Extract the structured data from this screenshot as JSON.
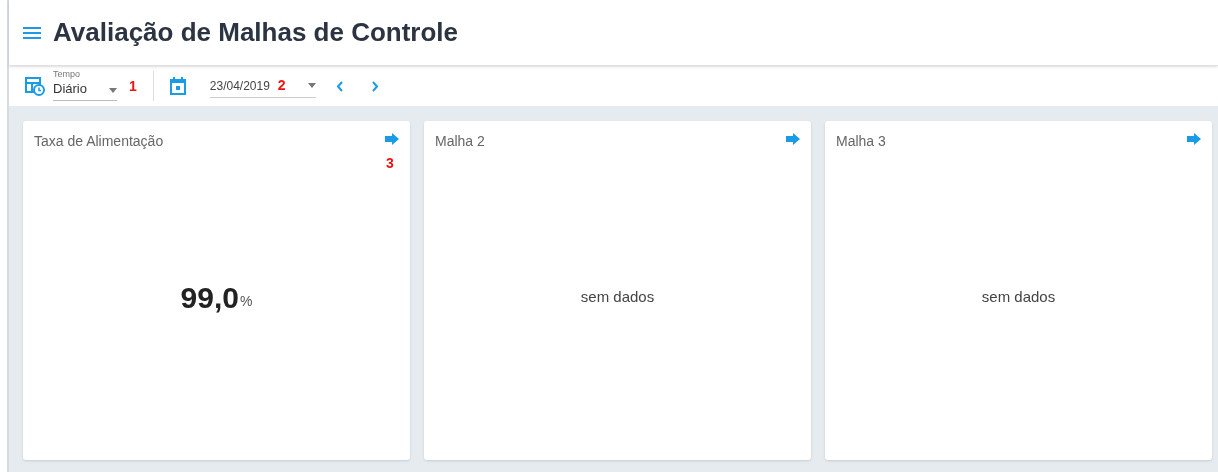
{
  "header": {
    "title": "Avaliação de Malhas de Controle"
  },
  "toolbar": {
    "period": {
      "label": "Tempo",
      "value": "Diário",
      "marker": "1"
    },
    "date": {
      "value": "23/04/2019",
      "marker": "2"
    }
  },
  "cards": [
    {
      "kind": "value",
      "title": "Taxa de Alimentação",
      "marker": "3",
      "value": "99,0",
      "unit": "%"
    },
    {
      "kind": "empty",
      "title": "Malha 2",
      "message": "sem dados"
    },
    {
      "kind": "empty",
      "title": "Malha 3",
      "message": "sem dados"
    }
  ]
}
